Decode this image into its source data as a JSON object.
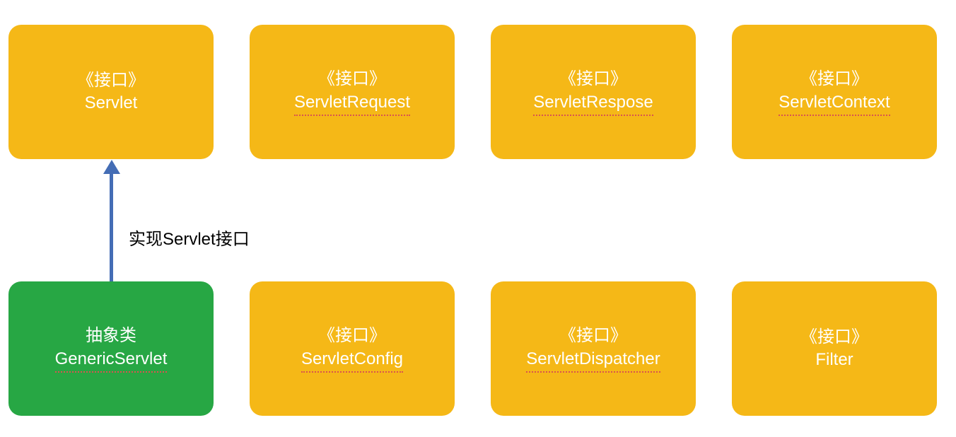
{
  "boxes": {
    "servlet": {
      "stereotype": "《接口》",
      "name": "Servlet"
    },
    "servletRequest": {
      "stereotype": "《接口》",
      "name": "ServletRequest"
    },
    "servletResponse": {
      "stereotype": "《接口》",
      "name": "ServletRespose"
    },
    "servletContext": {
      "stereotype": "《接口》",
      "name": "ServletContext"
    },
    "genericServlet": {
      "stereotype": "抽象类",
      "name": "GenericServlet"
    },
    "servletConfig": {
      "stereotype": "《接口》",
      "name": "ServletConfig"
    },
    "servletDispatcher": {
      "stereotype": "《接口》",
      "name": "ServletDispatcher"
    },
    "filter": {
      "stereotype": "《接口》",
      "name": "Filter"
    }
  },
  "arrow": {
    "label": "实现Servlet接口"
  },
  "colors": {
    "orange": "#f5b817",
    "green": "#27a744",
    "arrowBlue": "#446db5"
  }
}
